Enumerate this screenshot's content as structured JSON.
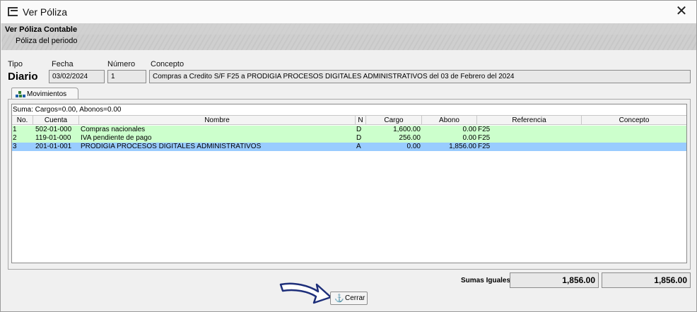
{
  "window": {
    "title": "Ver Póliza"
  },
  "header": {
    "title": "Ver Póliza Contable",
    "subtitle": "Póliza del periodo"
  },
  "form": {
    "tipo_label": "Tipo",
    "fecha_label": "Fecha",
    "numero_label": "Número",
    "concepto_label": "Concepto",
    "tipo": "Diario",
    "fecha": "03/02/2024",
    "numero": "1",
    "concepto": "Compras a Credito S/F F25 a PRODIGIA PROCESOS DIGITALES ADMINISTRATIVOS del 03 de Febrero del 2024"
  },
  "tab": {
    "label": "Movimientos",
    "icon": "grid-icon"
  },
  "grid": {
    "summary": "Suma: Cargos=0.00, Abonos=0.00",
    "columns": [
      "No.",
      "Cuenta",
      "Nombre",
      "N",
      "Cargo",
      "Abono",
      "Referencia",
      "Concepto"
    ],
    "rows": [
      {
        "no": "1",
        "cuenta": "502-01-000",
        "nombre": "Compras nacionales",
        "n": "D",
        "cargo": "1,600.00",
        "abono": "0.00",
        "referencia": "F25",
        "concepto": ""
      },
      {
        "no": "2",
        "cuenta": "119-01-000",
        "nombre": "IVA pendiente de pago",
        "n": "D",
        "cargo": "256.00",
        "abono": "0.00",
        "referencia": "F25",
        "concepto": ""
      },
      {
        "no": "3",
        "cuenta": "201-01-001",
        "nombre": "PRODIGIA PROCESOS DIGITALES ADMINISTRATIVOS",
        "n": "A",
        "cargo": "0.00",
        "abono": "1,856.00",
        "referencia": "F25",
        "concepto": ""
      }
    ],
    "row_colors": {
      "normal": "#ccffcc",
      "selected": "#99ccff"
    }
  },
  "footer": {
    "sumas_label": "Sumas Iguales:",
    "total_cargos": "1,856.00",
    "total_abonos": "1,856.00",
    "cerrar_label": "Cerrar",
    "cerrar_icon": "anchor-icon"
  }
}
